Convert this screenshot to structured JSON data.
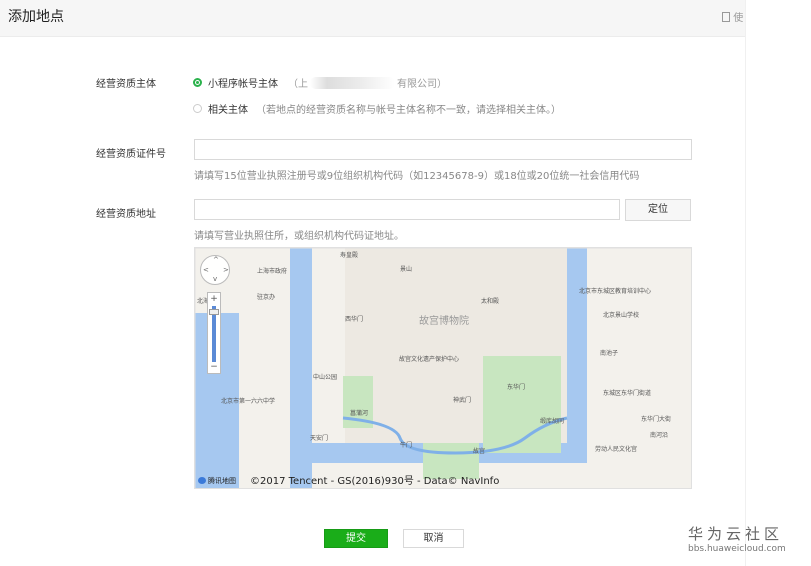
{
  "header": {
    "title": "添加地点",
    "doc_link": "使"
  },
  "form": {
    "entity": {
      "label": "经营资质主体",
      "option1_label": "小程序帐号主体",
      "option1_prefix": "（上",
      "option1_suffix": "有限公司）",
      "option2_label": "相关主体",
      "option2_hint": "（若地点的经营资质名称与帐号主体名称不一致，请选择相关主体。）"
    },
    "license": {
      "label": "经营资质证件号",
      "value": "",
      "hint": "请填写15位营业执照注册号或9位组织机构代码（如12345678-9）或18位或20位统一社会信用代码"
    },
    "address": {
      "label": "经营资质地址",
      "value": "",
      "locate_label": "定位",
      "hint": "请填写营业执照住所，或组织机构代码证地址。"
    }
  },
  "map": {
    "labels": {
      "l1": "寿皇殿",
      "l2": "上海市政府",
      "l3": "驻京办",
      "l4": "景山",
      "l5": "北京市东城区教育培训中心",
      "l6": "北京景山学校",
      "l7": "西华门",
      "l8": "故宫博物院",
      "l9": "太和殿",
      "l10": "故宫文化遗产保护中心",
      "l11": "中山公园",
      "l12": "北京市第一六六中学",
      "l13": "南池子",
      "l14": "东华门",
      "l15": "东城区东华门街道",
      "l16": "劳动人民文化宫",
      "l17": "天安门",
      "l18": "菖蒲河",
      "l19": "北海",
      "l20": "午门",
      "l21": "神武门",
      "l22": "东华门大街",
      "l23": "南河沿",
      "l24": "故宫",
      "l25": "缎库胡同"
    },
    "logo": "腾讯地图",
    "copyright": "©2017 Tencent - GS(2016)930号 - Data© NavInfo"
  },
  "actions": {
    "submit": "提交",
    "cancel": "取消"
  },
  "watermark": {
    "line1": "华为云社区",
    "line2": "bbs.huaweicloud.com"
  },
  "colors": {
    "accent": "#1aad19",
    "water": "#a6c8f0",
    "park": "#c8e6c0"
  }
}
